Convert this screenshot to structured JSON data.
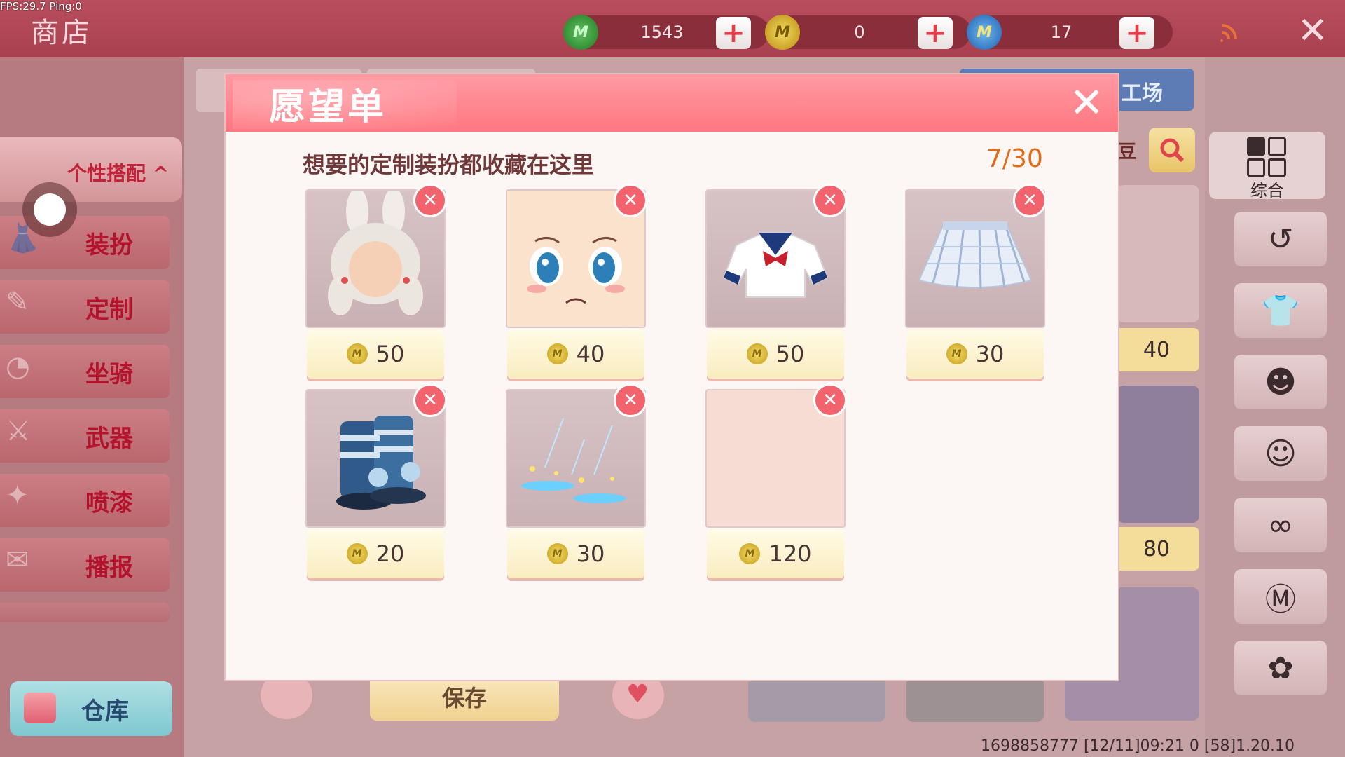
{
  "debug": {
    "fps_text": "FPS:29.7  Ping:0"
  },
  "header": {
    "title": "商店"
  },
  "currencies": [
    {
      "icon": "green-coin-icon",
      "value": "1543",
      "color": "#3a9a3a"
    },
    {
      "icon": "gold-coin-icon",
      "value": "0",
      "color": "#e0b520"
    },
    {
      "icon": "blue-coin-icon",
      "value": "17",
      "color": "#3a7fd0"
    }
  ],
  "coin_letter": "M",
  "plus_glyph": "+",
  "close_glyph": "✕",
  "sidebar": {
    "group_label": "个性搭配",
    "group_arrow": "^",
    "items": [
      {
        "label": "装扮",
        "icon": "outfit-icon"
      },
      {
        "label": "定制",
        "icon": "custom-icon"
      },
      {
        "label": "坐骑",
        "icon": "mount-icon"
      },
      {
        "label": "武器",
        "icon": "weapon-icon"
      },
      {
        "label": "喷漆",
        "icon": "spray-icon"
      },
      {
        "label": "播报",
        "icon": "broadcast-icon"
      }
    ],
    "warehouse_label": "仓库"
  },
  "background": {
    "right_tab_label": "工场",
    "search_suffix": "豆",
    "category_label": "综合",
    "side_prices": [
      "40",
      "80"
    ],
    "save_label": "保存"
  },
  "wishlist": {
    "title": "愿望单",
    "subtitle": "想要的定制装扮都收藏在这里",
    "count": "7/30",
    "items": [
      {
        "name": "white-bunny-hair",
        "price": "50"
      },
      {
        "name": "blue-eyes-face",
        "price": "40"
      },
      {
        "name": "sailor-top",
        "price": "50"
      },
      {
        "name": "plaid-skirt",
        "price": "30"
      },
      {
        "name": "striped-boots",
        "price": "20"
      },
      {
        "name": "sparkle-effect",
        "price": "30"
      },
      {
        "name": "empty-item",
        "price": "120"
      }
    ]
  },
  "status_bar": {
    "text": "1698858777   [12/11]09:21 0     [58]1.20.10"
  }
}
